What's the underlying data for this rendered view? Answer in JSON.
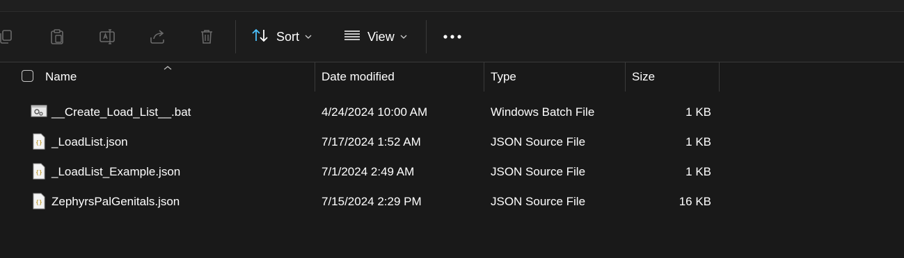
{
  "toolbar": {
    "sort_label": "Sort",
    "view_label": "View",
    "icons": [
      "copy-icon",
      "paste-icon",
      "rename-icon",
      "share-icon",
      "delete-icon",
      "sort-icon",
      "view-icon",
      "more-icon"
    ]
  },
  "columns": {
    "name": "Name",
    "date_modified": "Date modified",
    "type": "Type",
    "size": "Size"
  },
  "files": [
    {
      "name": "__Create_Load_List__.bat",
      "date": "4/24/2024 10:00 AM",
      "type": "Windows Batch File",
      "size": "1 KB",
      "icon": "batch-file-icon"
    },
    {
      "name": "_LoadList.json",
      "date": "7/17/2024 1:52 AM",
      "type": "JSON Source File",
      "size": "1 KB",
      "icon": "json-file-icon"
    },
    {
      "name": "_LoadList_Example.json",
      "date": "7/1/2024 2:49 AM",
      "type": "JSON Source File",
      "size": "1 KB",
      "icon": "json-file-icon"
    },
    {
      "name": "ZephyrsPalGenitals.json",
      "date": "7/15/2024 2:29 PM",
      "type": "JSON Source File",
      "size": "16 KB",
      "icon": "json-file-icon"
    }
  ],
  "colors": {
    "background": "#191919",
    "toolbar": "#1c1c1c",
    "divider": "#3a3a3a",
    "accent": "#4cc2ff"
  }
}
